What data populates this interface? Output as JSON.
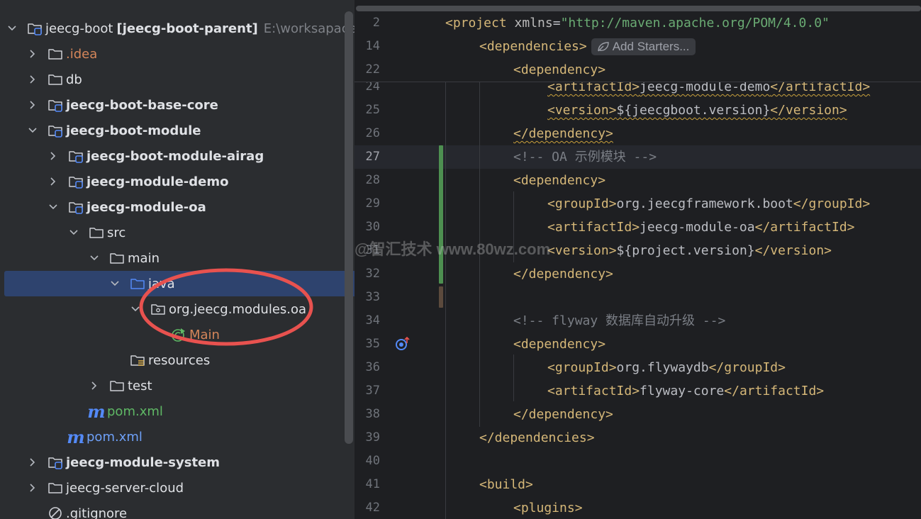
{
  "tree": {
    "rows": [
      {
        "name": "tree-root-jeecg-boot",
        "depth": 0,
        "chevron": "down",
        "icon": "module-folder",
        "label": "jeecg-boot",
        "module": "[jeecg-boot-parent]",
        "suffix": "E:\\worksapace\\jee",
        "style": ""
      },
      {
        "name": "tree-idea",
        "depth": 1,
        "chevron": "right",
        "icon": "folder",
        "label": ".idea",
        "style": "orange"
      },
      {
        "name": "tree-db",
        "depth": 1,
        "chevron": "right",
        "icon": "folder",
        "label": "db",
        "style": ""
      },
      {
        "name": "tree-jeecg-boot-base-core",
        "depth": 1,
        "chevron": "right",
        "icon": "module-folder",
        "label": "jeecg-boot-base-core",
        "style": "bold"
      },
      {
        "name": "tree-jeecg-boot-module",
        "depth": 1,
        "chevron": "down",
        "icon": "module-folder",
        "label": "jeecg-boot-module",
        "style": "bold"
      },
      {
        "name": "tree-jeecg-boot-module-airag",
        "depth": 2,
        "chevron": "right",
        "icon": "module-folder",
        "label": "jeecg-boot-module-airag",
        "style": "bold"
      },
      {
        "name": "tree-jeecg-module-demo",
        "depth": 2,
        "chevron": "right",
        "icon": "module-folder",
        "label": "jeecg-module-demo",
        "style": "bold"
      },
      {
        "name": "tree-jeecg-module-oa",
        "depth": 2,
        "chevron": "down",
        "icon": "module-folder",
        "label": "jeecg-module-oa",
        "style": "bold"
      },
      {
        "name": "tree-src",
        "depth": 3,
        "chevron": "down",
        "icon": "folder",
        "label": "src",
        "style": ""
      },
      {
        "name": "tree-main",
        "depth": 4,
        "chevron": "down",
        "icon": "folder",
        "label": "main",
        "style": ""
      },
      {
        "name": "tree-java",
        "depth": 5,
        "chevron": "down",
        "icon": "source-folder",
        "label": "java",
        "style": "",
        "selected": true
      },
      {
        "name": "tree-package-oa",
        "depth": 6,
        "chevron": "down",
        "icon": "package",
        "label": "org.jeecg.modules.oa",
        "style": ""
      },
      {
        "name": "tree-main-class",
        "depth": 7,
        "chevron": "none",
        "icon": "class",
        "label": "Main",
        "style": "orange"
      },
      {
        "name": "tree-resources",
        "depth": 5,
        "chevron": "none",
        "icon": "resources-folder",
        "label": "resources",
        "style": ""
      },
      {
        "name": "tree-test",
        "depth": 4,
        "chevron": "right",
        "icon": "folder",
        "label": "test",
        "style": ""
      },
      {
        "name": "tree-pom-oa",
        "depth": 3,
        "chevron": "none",
        "icon": "maven",
        "label": "pom.xml",
        "style": "green"
      },
      {
        "name": "tree-pom-module",
        "depth": 2,
        "chevron": "none",
        "icon": "maven",
        "label": "pom.xml",
        "style": "blue"
      },
      {
        "name": "tree-jeecg-module-system",
        "depth": 1,
        "chevron": "right",
        "icon": "module-folder",
        "label": "jeecg-module-system",
        "style": "bold"
      },
      {
        "name": "tree-jeecg-server-cloud",
        "depth": 1,
        "chevron": "right",
        "icon": "folder",
        "label": "jeecg-server-cloud",
        "style": ""
      },
      {
        "name": "tree-gitignore",
        "depth": 1,
        "chevron": "none",
        "icon": "ignore",
        "label": ".gitignore",
        "style": ""
      }
    ],
    "maven_glyph": "m"
  },
  "editor": {
    "add_starters": "Add Starters...",
    "sticky_lines": [
      {
        "num": "2",
        "code": [
          [
            "t",
            "<project "
          ],
          [
            "an",
            "xmlns"
          ],
          [
            "ctext",
            "="
          ],
          [
            "av",
            "\"http://maven.apache.org/POM/4.0.0\""
          ]
        ]
      },
      {
        "num": "14",
        "code": [
          [
            "t",
            "<dependencies>"
          ]
        ],
        "chip": true
      },
      {
        "num": "22",
        "code": [
          [
            "t",
            "<dependency>"
          ]
        ]
      }
    ],
    "lines": [
      {
        "num": "24",
        "code": [
          [
            "t",
            "<artifactId>"
          ],
          [
            "ctext",
            "jeecg-module-demo"
          ],
          [
            "t",
            "</artifactId>"
          ]
        ],
        "wavy": true
      },
      {
        "num": "25",
        "code": [
          [
            "t",
            "<version>"
          ],
          [
            "ctext",
            "${jeecgboot.version}"
          ],
          [
            "t",
            "</version>"
          ]
        ],
        "wavy": true
      },
      {
        "num": "26",
        "code": [
          [
            "t",
            "</dependency>"
          ]
        ],
        "wavy": true
      },
      {
        "num": "27",
        "code": [
          [
            "cm",
            "<!-- OA 示例模块 -->"
          ]
        ],
        "current": true
      },
      {
        "num": "28",
        "code": [
          [
            "t",
            "<dependency>"
          ]
        ]
      },
      {
        "num": "29",
        "code": [
          [
            "t",
            "<groupId>"
          ],
          [
            "ctext",
            "org.jeecgframework.boot"
          ],
          [
            "t",
            "</groupId>"
          ]
        ]
      },
      {
        "num": "30",
        "code": [
          [
            "t",
            "<artifactId>"
          ],
          [
            "ctext",
            "jeecg-module-oa"
          ],
          [
            "t",
            "</artifactId>"
          ]
        ]
      },
      {
        "num": "31",
        "code": [
          [
            "t",
            "<version>"
          ],
          [
            "ctext",
            "${project.version}"
          ],
          [
            "t",
            "</version>"
          ]
        ]
      },
      {
        "num": "32",
        "code": [
          [
            "t",
            "</dependency>"
          ]
        ]
      },
      {
        "num": "33",
        "code": []
      },
      {
        "num": "34",
        "code": [
          [
            "cm",
            "<!-- flyway 数据库自动升级 -->"
          ]
        ]
      },
      {
        "num": "35",
        "code": [
          [
            "t",
            "<dependency>"
          ]
        ]
      },
      {
        "num": "36",
        "code": [
          [
            "t",
            "<groupId>"
          ],
          [
            "ctext",
            "org.flywaydb"
          ],
          [
            "t",
            "</groupId>"
          ]
        ]
      },
      {
        "num": "37",
        "code": [
          [
            "t",
            "<artifactId>"
          ],
          [
            "ctext",
            "flyway-core"
          ],
          [
            "t",
            "</artifactId>"
          ]
        ]
      },
      {
        "num": "38",
        "code": [
          [
            "t",
            "</dependency>"
          ]
        ]
      },
      {
        "num": "39",
        "code": [
          [
            "t",
            "</dependencies>"
          ]
        ]
      },
      {
        "num": "40",
        "code": []
      },
      {
        "num": "41",
        "code": [
          [
            "t",
            "<build>"
          ]
        ]
      },
      {
        "num": "42",
        "code": [
          [
            "t",
            "<plugins>"
          ]
        ]
      }
    ]
  },
  "watermark": "@智汇技术 www.80wz.com",
  "colors": {
    "tag": "#d5b778",
    "comment": "#7a7e85",
    "text": "#bcbec4",
    "selection": "#2e436e",
    "annotation": "#e8524f",
    "vcs_added": "#4d8f50"
  }
}
